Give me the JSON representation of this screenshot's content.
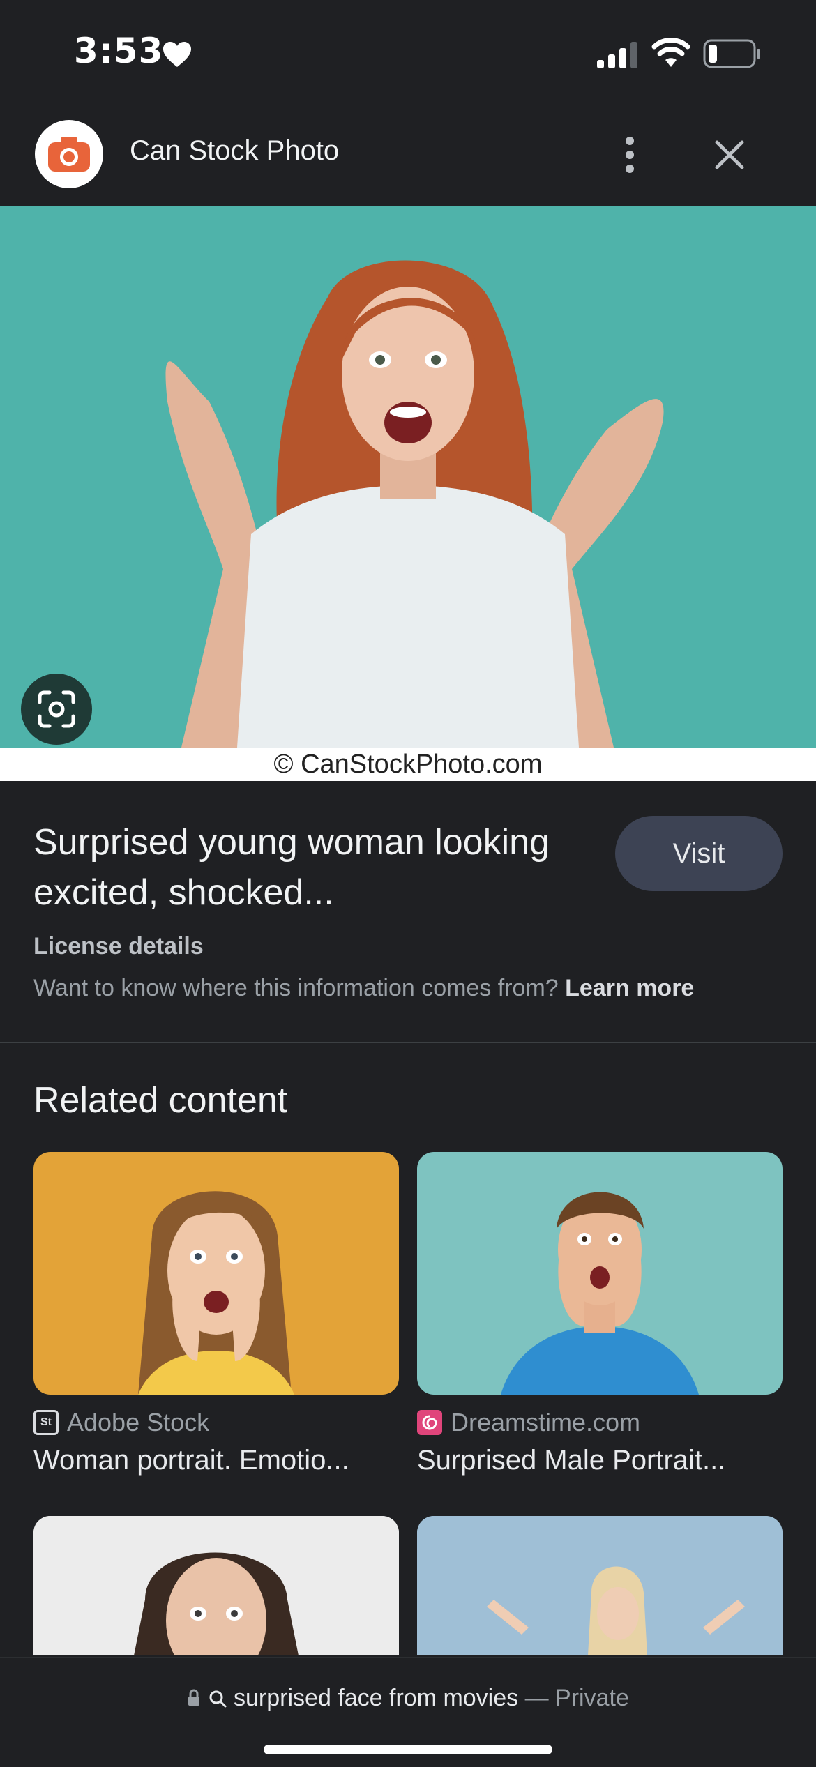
{
  "status_bar": {
    "time": "3:53",
    "icons": [
      "heart-icon",
      "cellular-signal-icon",
      "wifi-icon",
      "battery-icon"
    ]
  },
  "header": {
    "site_name": "Can Stock Photo",
    "icons": [
      "camera-logo-icon",
      "more-vert-icon",
      "close-icon"
    ]
  },
  "hero": {
    "watermark": "© CanStockPhoto.com",
    "lens_icon": "google-lens-icon"
  },
  "info": {
    "title": "Surprised young woman looking excited, shocked...",
    "visit_label": "Visit",
    "license_label": "License details",
    "question": "Want to know where this information comes from?",
    "learn_more": "Learn more"
  },
  "related": {
    "heading": "Related content",
    "cards": [
      {
        "source": "Adobe Stock",
        "title": "Woman portrait. Emotio..."
      },
      {
        "source": "Dreamstime.com",
        "title": "Surprised Male Portrait..."
      }
    ]
  },
  "bottom_bar": {
    "query": "surprised face from movies",
    "private_label": "— Private"
  },
  "colors": {
    "background": "#1f2023",
    "hero_bg": "#4fb3aa",
    "visit_button": "#3d4354",
    "logo_orange": "#e8643a",
    "card1_bg": "#e3a338",
    "card2_bg": "#7ec3c0"
  }
}
